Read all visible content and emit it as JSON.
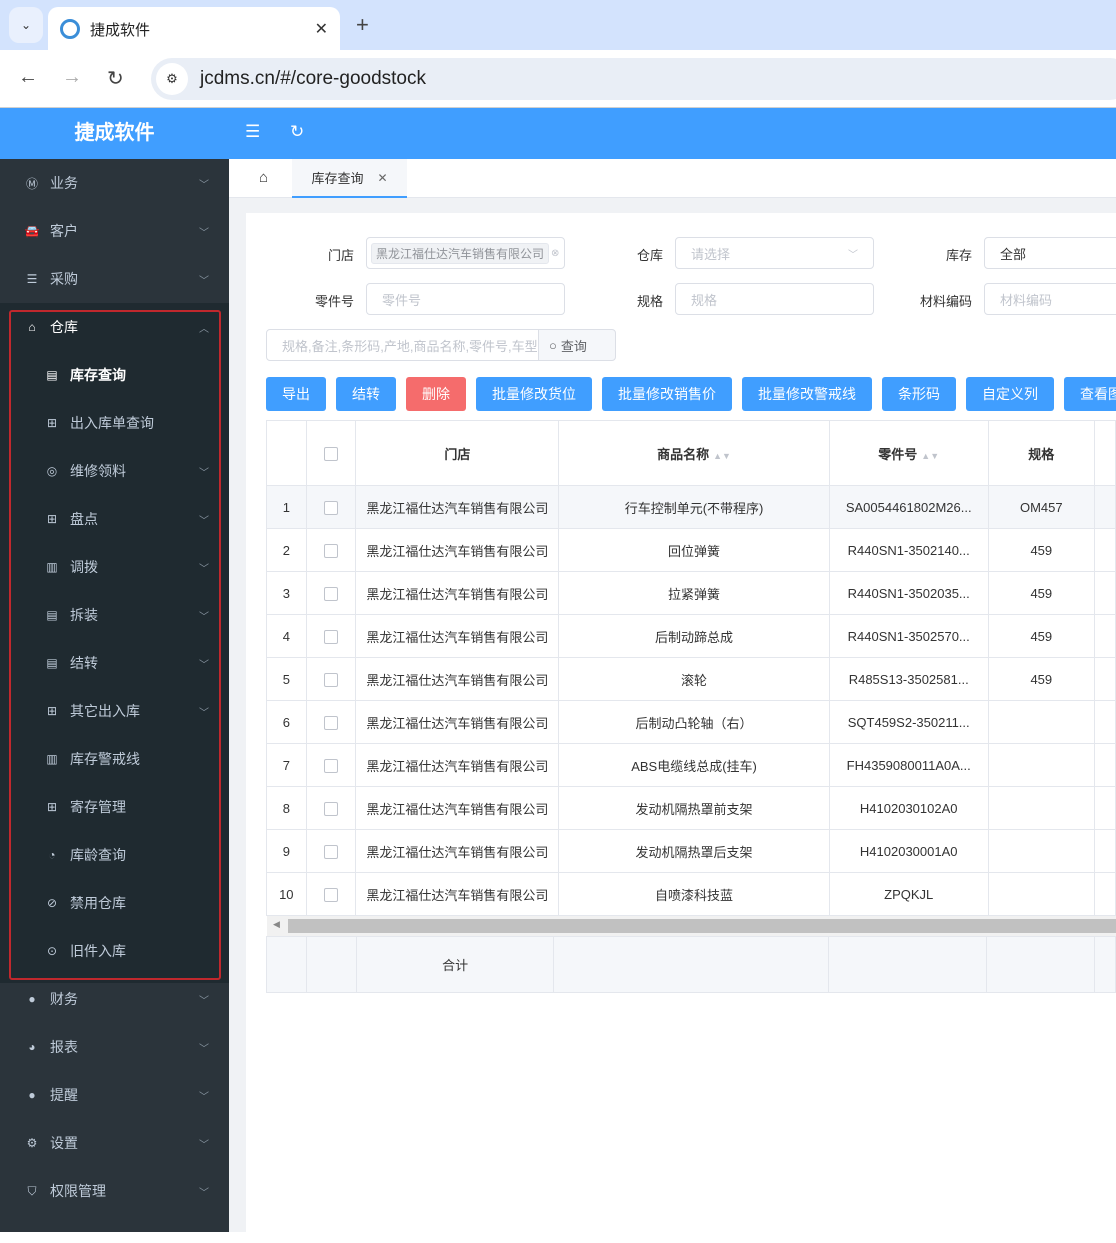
{
  "browser": {
    "tab_title": "捷成软件",
    "url": "jcdms.cn/#/core-goodstock"
  },
  "app": {
    "title": "捷成软件"
  },
  "sidebar": {
    "items": [
      {
        "label": "业务",
        "icon": "m-icon"
      },
      {
        "label": "客户",
        "icon": "car-icon"
      },
      {
        "label": "采购",
        "icon": "server-icon"
      },
      {
        "label": "仓库",
        "icon": "home-icon"
      },
      {
        "label": "库存查询",
        "icon": "doc-icon",
        "active": true
      },
      {
        "label": "出入库单查询",
        "icon": "grid-icon"
      },
      {
        "label": "维修领料",
        "icon": "cycle-icon"
      },
      {
        "label": "盘点",
        "icon": "grid-icon"
      },
      {
        "label": "调拨",
        "icon": "board-icon"
      },
      {
        "label": "拆装",
        "icon": "list-icon"
      },
      {
        "label": "结转",
        "icon": "list-icon"
      },
      {
        "label": "其它出入库",
        "icon": "grid-icon"
      },
      {
        "label": "库存警戒线",
        "icon": "board-icon"
      },
      {
        "label": "寄存管理",
        "icon": "grid-icon"
      },
      {
        "label": "库龄查询",
        "icon": "gauge-icon"
      },
      {
        "label": "禁用仓库",
        "icon": "ban-icon"
      },
      {
        "label": "旧件入库",
        "icon": "upload-icon"
      },
      {
        "label": "财务",
        "icon": "money-icon"
      },
      {
        "label": "报表",
        "icon": "pie-icon"
      },
      {
        "label": "提醒",
        "icon": "bulb-icon"
      },
      {
        "label": "设置",
        "icon": "gear-icon"
      },
      {
        "label": "权限管理",
        "icon": "shield-icon"
      }
    ]
  },
  "tags": {
    "active": "库存查询"
  },
  "filters": {
    "store_label": "门店",
    "store_value": "黑龙江福仕达汽车销售有限公司",
    "warehouse_label": "仓库",
    "warehouse_placeholder": "请选择",
    "stock_label": "库存",
    "stock_value": "全部",
    "part_label": "零件号",
    "part_placeholder": "零件号",
    "spec_label": "规格",
    "spec_placeholder": "规格",
    "material_label": "材料编码",
    "material_placeholder": "材料编码",
    "search_placeholder": "规格,备注,条形码,产地,商品名称,零件号,车型",
    "search_button": "查询"
  },
  "actions": [
    "导出",
    "结转",
    "删除",
    "批量修改货位",
    "批量修改销售价",
    "批量修改警戒线",
    "条形码",
    "自定义列",
    "查看图"
  ],
  "colors": {
    "primary": "#409eff",
    "danger": "#f56c6c",
    "sidebar": "#2b343b"
  },
  "table": {
    "columns": [
      "门店",
      "商品名称",
      "零件号",
      "规格"
    ],
    "rows": [
      [
        "1",
        "黑龙江福仕达汽车销售有限公司",
        "行车控制单元(不带程序)",
        "SA0054461802M26...",
        "OM457"
      ],
      [
        "2",
        "黑龙江福仕达汽车销售有限公司",
        "回位弹簧",
        "R440SN1-3502140...",
        "459"
      ],
      [
        "3",
        "黑龙江福仕达汽车销售有限公司",
        "拉紧弹簧",
        "R440SN1-3502035...",
        "459"
      ],
      [
        "4",
        "黑龙江福仕达汽车销售有限公司",
        "后制动蹄总成",
        "R440SN1-3502570...",
        "459"
      ],
      [
        "5",
        "黑龙江福仕达汽车销售有限公司",
        "滚轮",
        "R485S13-3502581...",
        "459"
      ],
      [
        "6",
        "黑龙江福仕达汽车销售有限公司",
        "后制动凸轮轴（右）",
        "SQT459S2-350211...",
        ""
      ],
      [
        "7",
        "黑龙江福仕达汽车销售有限公司",
        "ABS电缆线总成(挂车)",
        "FH4359080011A0A...",
        ""
      ],
      [
        "8",
        "黑龙江福仕达汽车销售有限公司",
        "发动机隔热罩前支架",
        "H4102030102A0",
        ""
      ],
      [
        "9",
        "黑龙江福仕达汽车销售有限公司",
        "发动机隔热罩后支架",
        "H4102030001A0",
        ""
      ],
      [
        "10",
        "黑龙江福仕达汽车销售有限公司",
        "自喷漆科技蓝",
        "ZPQKJL",
        ""
      ]
    ],
    "footer_label": "合计"
  }
}
